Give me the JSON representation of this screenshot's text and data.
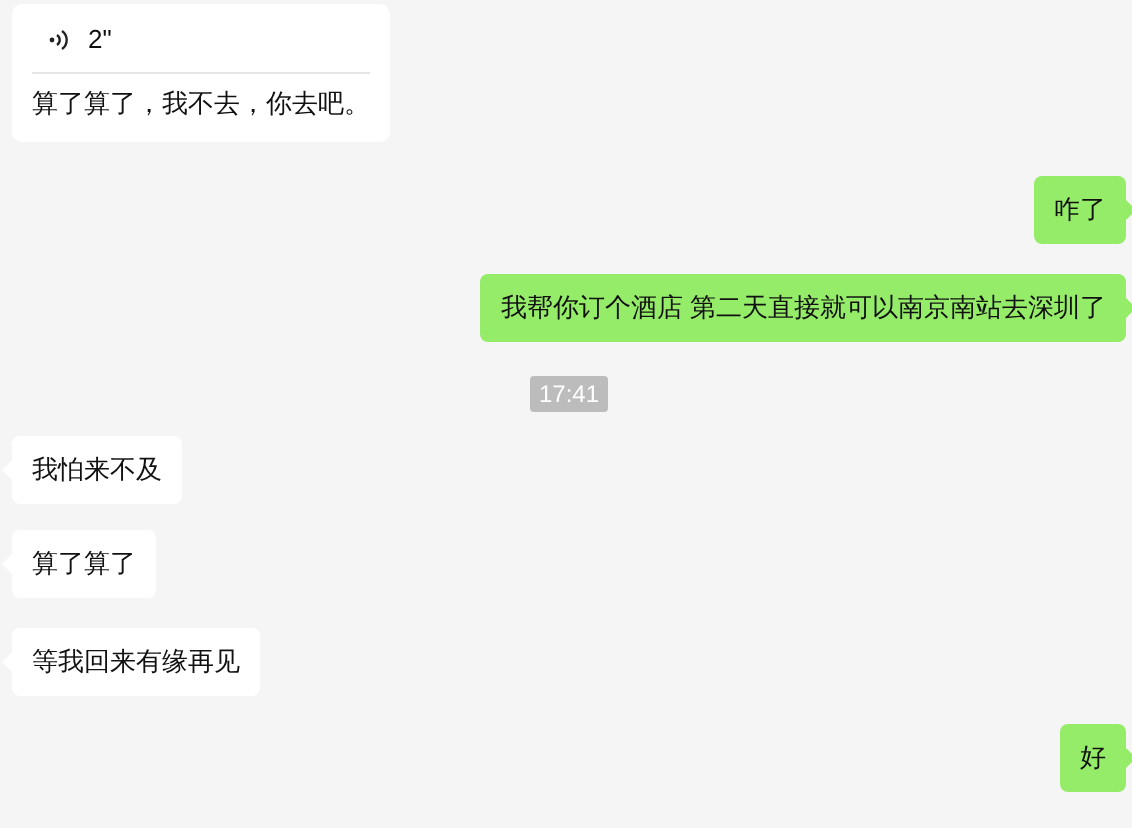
{
  "messages": [
    {
      "kind": "voice",
      "outgoing": false,
      "duration": "2\"",
      "transcript": "算了算了，我不去，你去吧。"
    },
    {
      "kind": "text",
      "outgoing": true,
      "text": "咋了"
    },
    {
      "kind": "text",
      "outgoing": true,
      "text": "我帮你订个酒店 第二天直接就可以南京南站去深圳了"
    },
    {
      "kind": "time",
      "text": "17:41"
    },
    {
      "kind": "text",
      "outgoing": false,
      "text": "我怕来不及"
    },
    {
      "kind": "text",
      "outgoing": false,
      "text": "算了算了"
    },
    {
      "kind": "text",
      "outgoing": false,
      "text": "等我回来有缘再见"
    },
    {
      "kind": "text",
      "outgoing": true,
      "text": "好"
    }
  ]
}
